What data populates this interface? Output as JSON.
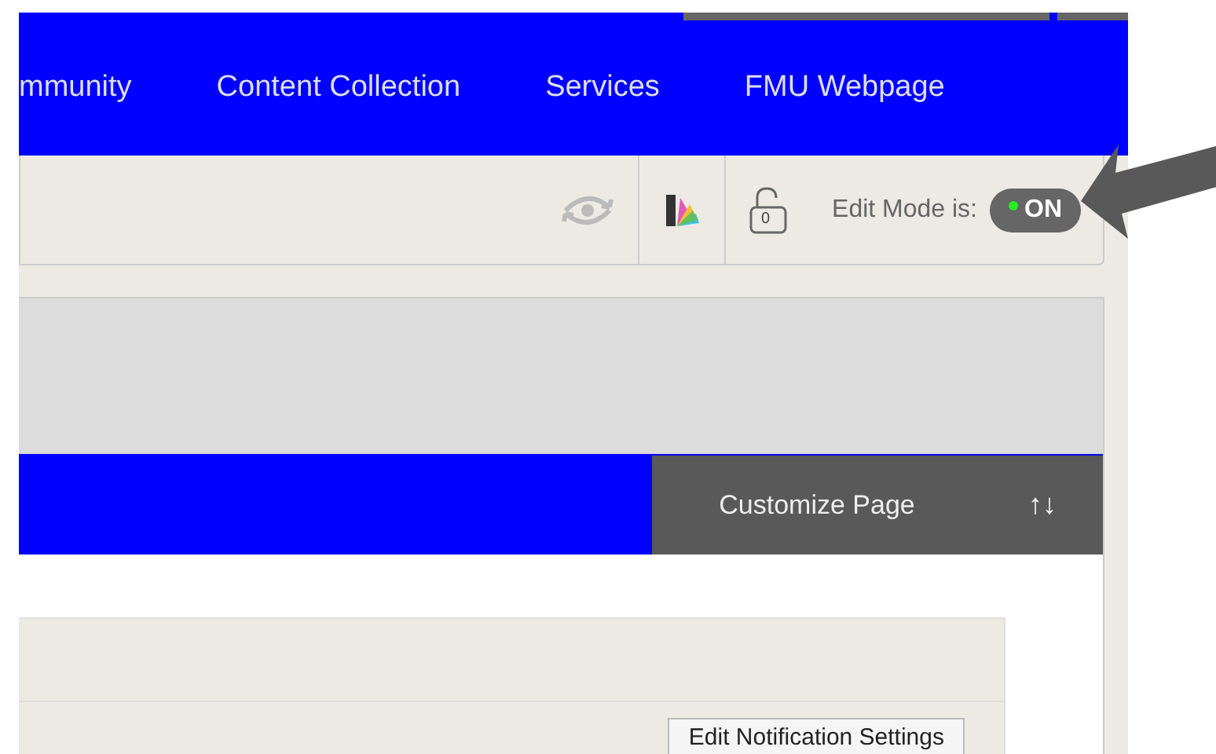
{
  "nav": {
    "items": [
      {
        "label": "mmunity"
      },
      {
        "label": "Content Collection"
      },
      {
        "label": "Services"
      },
      {
        "label": "FMU Webpage"
      }
    ]
  },
  "toolbar": {
    "lock_count": "0",
    "edit_mode_label": "Edit Mode is:",
    "edit_mode": {
      "label": "ON",
      "on": true
    }
  },
  "page_header": {
    "customize_label": "Customize Page",
    "sort_icon": "↑↓"
  },
  "module": {
    "button": "Edit Notification Settings"
  }
}
